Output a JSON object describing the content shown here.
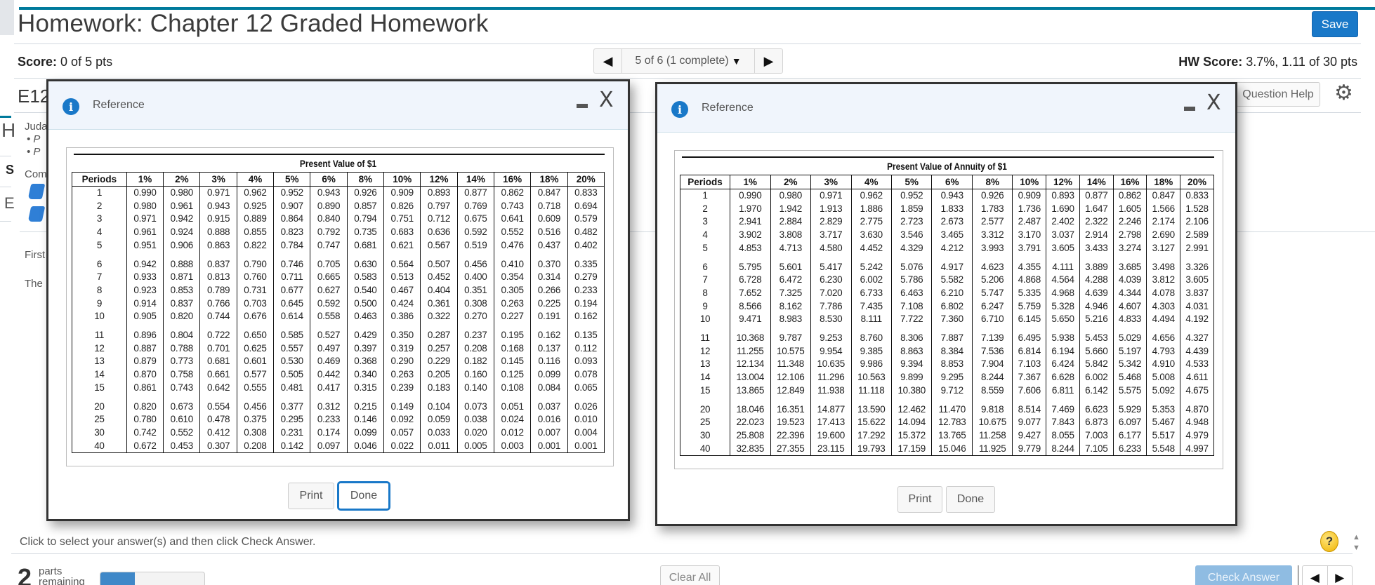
{
  "header": {
    "title": "Homework: Chapter 12 Graded Homework",
    "save_label": "Save",
    "score_label": "Score:",
    "score_value": "0 of 5 pts",
    "hw_score_label": "HW Score:",
    "hw_score_value": "3.7%, 1.11 of 30 pts",
    "nav": {
      "prev_icon": "◀",
      "position": "5 of 6 (1 complete)",
      "dropdown_icon": "▼",
      "next_icon": "▶"
    },
    "question_id": "E12",
    "question_help_label": "Question Help"
  },
  "background": {
    "partial_texts": [
      "Juda",
      "• P",
      "• P",
      "Com",
      "First",
      "The"
    ],
    "left_edge_texts": [
      "H",
      "S",
      "E"
    ]
  },
  "popups": [
    {
      "title": "Reference",
      "minimize_icon": "minimize",
      "close_icon": "X",
      "print_label": "Print",
      "done_label": "Done",
      "table": {
        "title": "Present Value of $1",
        "columns": [
          "Periods",
          "1%",
          "2%",
          "3%",
          "4%",
          "5%",
          "6%",
          "8%",
          "10%",
          "12%",
          "14%",
          "16%",
          "18%",
          "20%"
        ],
        "rows": [
          [
            "1",
            "0.990",
            "0.980",
            "0.971",
            "0.962",
            "0.952",
            "0.943",
            "0.926",
            "0.909",
            "0.893",
            "0.877",
            "0.862",
            "0.847",
            "0.833"
          ],
          [
            "2",
            "0.980",
            "0.961",
            "0.943",
            "0.925",
            "0.907",
            "0.890",
            "0.857",
            "0.826",
            "0.797",
            "0.769",
            "0.743",
            "0.718",
            "0.694"
          ],
          [
            "3",
            "0.971",
            "0.942",
            "0.915",
            "0.889",
            "0.864",
            "0.840",
            "0.794",
            "0.751",
            "0.712",
            "0.675",
            "0.641",
            "0.609",
            "0.579"
          ],
          [
            "4",
            "0.961",
            "0.924",
            "0.888",
            "0.855",
            "0.823",
            "0.792",
            "0.735",
            "0.683",
            "0.636",
            "0.592",
            "0.552",
            "0.516",
            "0.482"
          ],
          [
            "5",
            "0.951",
            "0.906",
            "0.863",
            "0.822",
            "0.784",
            "0.747",
            "0.681",
            "0.621",
            "0.567",
            "0.519",
            "0.476",
            "0.437",
            "0.402"
          ],
          [
            "6",
            "0.942",
            "0.888",
            "0.837",
            "0.790",
            "0.746",
            "0.705",
            "0.630",
            "0.564",
            "0.507",
            "0.456",
            "0.410",
            "0.370",
            "0.335"
          ],
          [
            "7",
            "0.933",
            "0.871",
            "0.813",
            "0.760",
            "0.711",
            "0.665",
            "0.583",
            "0.513",
            "0.452",
            "0.400",
            "0.354",
            "0.314",
            "0.279"
          ],
          [
            "8",
            "0.923",
            "0.853",
            "0.789",
            "0.731",
            "0.677",
            "0.627",
            "0.540",
            "0.467",
            "0.404",
            "0.351",
            "0.305",
            "0.266",
            "0.233"
          ],
          [
            "9",
            "0.914",
            "0.837",
            "0.766",
            "0.703",
            "0.645",
            "0.592",
            "0.500",
            "0.424",
            "0.361",
            "0.308",
            "0.263",
            "0.225",
            "0.194"
          ],
          [
            "10",
            "0.905",
            "0.820",
            "0.744",
            "0.676",
            "0.614",
            "0.558",
            "0.463",
            "0.386",
            "0.322",
            "0.270",
            "0.227",
            "0.191",
            "0.162"
          ],
          [
            "11",
            "0.896",
            "0.804",
            "0.722",
            "0.650",
            "0.585",
            "0.527",
            "0.429",
            "0.350",
            "0.287",
            "0.237",
            "0.195",
            "0.162",
            "0.135"
          ],
          [
            "12",
            "0.887",
            "0.788",
            "0.701",
            "0.625",
            "0.557",
            "0.497",
            "0.397",
            "0.319",
            "0.257",
            "0.208",
            "0.168",
            "0.137",
            "0.112"
          ],
          [
            "13",
            "0.879",
            "0.773",
            "0.681",
            "0.601",
            "0.530",
            "0.469",
            "0.368",
            "0.290",
            "0.229",
            "0.182",
            "0.145",
            "0.116",
            "0.093"
          ],
          [
            "14",
            "0.870",
            "0.758",
            "0.661",
            "0.577",
            "0.505",
            "0.442",
            "0.340",
            "0.263",
            "0.205",
            "0.160",
            "0.125",
            "0.099",
            "0.078"
          ],
          [
            "15",
            "0.861",
            "0.743",
            "0.642",
            "0.555",
            "0.481",
            "0.417",
            "0.315",
            "0.239",
            "0.183",
            "0.140",
            "0.108",
            "0.084",
            "0.065"
          ],
          [
            "20",
            "0.820",
            "0.673",
            "0.554",
            "0.456",
            "0.377",
            "0.312",
            "0.215",
            "0.149",
            "0.104",
            "0.073",
            "0.051",
            "0.037",
            "0.026"
          ],
          [
            "25",
            "0.780",
            "0.610",
            "0.478",
            "0.375",
            "0.295",
            "0.233",
            "0.146",
            "0.092",
            "0.059",
            "0.038",
            "0.024",
            "0.016",
            "0.010"
          ],
          [
            "30",
            "0.742",
            "0.552",
            "0.412",
            "0.308",
            "0.231",
            "0.174",
            "0.099",
            "0.057",
            "0.033",
            "0.020",
            "0.012",
            "0.007",
            "0.004"
          ],
          [
            "40",
            "0.672",
            "0.453",
            "0.307",
            "0.208",
            "0.142",
            "0.097",
            "0.046",
            "0.022",
            "0.011",
            "0.005",
            "0.003",
            "0.001",
            "0.001"
          ]
        ]
      }
    },
    {
      "title": "Reference",
      "minimize_icon": "minimize",
      "close_icon": "X",
      "print_label": "Print",
      "done_label": "Done",
      "table": {
        "title": "Present Value of Annuity of $1",
        "columns": [
          "Periods",
          "1%",
          "2%",
          "3%",
          "4%",
          "5%",
          "6%",
          "8%",
          "10%",
          "12%",
          "14%",
          "16%",
          "18%",
          "20%"
        ],
        "rows": [
          [
            "1",
            "0.990",
            "0.980",
            "0.971",
            "0.962",
            "0.952",
            "0.943",
            "0.926",
            "0.909",
            "0.893",
            "0.877",
            "0.862",
            "0.847",
            "0.833"
          ],
          [
            "2",
            "1.970",
            "1.942",
            "1.913",
            "1.886",
            "1.859",
            "1.833",
            "1.783",
            "1.736",
            "1.690",
            "1.647",
            "1.605",
            "1.566",
            "1.528"
          ],
          [
            "3",
            "2.941",
            "2.884",
            "2.829",
            "2.775",
            "2.723",
            "2.673",
            "2.577",
            "2.487",
            "2.402",
            "2.322",
            "2.246",
            "2.174",
            "2.106"
          ],
          [
            "4",
            "3.902",
            "3.808",
            "3.717",
            "3.630",
            "3.546",
            "3.465",
            "3.312",
            "3.170",
            "3.037",
            "2.914",
            "2.798",
            "2.690",
            "2.589"
          ],
          [
            "5",
            "4.853",
            "4.713",
            "4.580",
            "4.452",
            "4.329",
            "4.212",
            "3.993",
            "3.791",
            "3.605",
            "3.433",
            "3.274",
            "3.127",
            "2.991"
          ],
          [
            "6",
            "5.795",
            "5.601",
            "5.417",
            "5.242",
            "5.076",
            "4.917",
            "4.623",
            "4.355",
            "4.111",
            "3.889",
            "3.685",
            "3.498",
            "3.326"
          ],
          [
            "7",
            "6.728",
            "6.472",
            "6.230",
            "6.002",
            "5.786",
            "5.582",
            "5.206",
            "4.868",
            "4.564",
            "4.288",
            "4.039",
            "3.812",
            "3.605"
          ],
          [
            "8",
            "7.652",
            "7.325",
            "7.020",
            "6.733",
            "6.463",
            "6.210",
            "5.747",
            "5.335",
            "4.968",
            "4.639",
            "4.344",
            "4.078",
            "3.837"
          ],
          [
            "9",
            "8.566",
            "8.162",
            "7.786",
            "7.435",
            "7.108",
            "6.802",
            "6.247",
            "5.759",
            "5.328",
            "4.946",
            "4.607",
            "4.303",
            "4.031"
          ],
          [
            "10",
            "9.471",
            "8.983",
            "8.530",
            "8.111",
            "7.722",
            "7.360",
            "6.710",
            "6.145",
            "5.650",
            "5.216",
            "4.833",
            "4.494",
            "4.192"
          ],
          [
            "11",
            "10.368",
            "9.787",
            "9.253",
            "8.760",
            "8.306",
            "7.887",
            "7.139",
            "6.495",
            "5.938",
            "5.453",
            "5.029",
            "4.656",
            "4.327"
          ],
          [
            "12",
            "11.255",
            "10.575",
            "9.954",
            "9.385",
            "8.863",
            "8.384",
            "7.536",
            "6.814",
            "6.194",
            "5.660",
            "5.197",
            "4.793",
            "4.439"
          ],
          [
            "13",
            "12.134",
            "11.348",
            "10.635",
            "9.986",
            "9.394",
            "8.853",
            "7.904",
            "7.103",
            "6.424",
            "5.842",
            "5.342",
            "4.910",
            "4.533"
          ],
          [
            "14",
            "13.004",
            "12.106",
            "11.296",
            "10.563",
            "9.899",
            "9.295",
            "8.244",
            "7.367",
            "6.628",
            "6.002",
            "5.468",
            "5.008",
            "4.611"
          ],
          [
            "15",
            "13.865",
            "12.849",
            "11.938",
            "11.118",
            "10.380",
            "9.712",
            "8.559",
            "7.606",
            "6.811",
            "6.142",
            "5.575",
            "5.092",
            "4.675"
          ],
          [
            "20",
            "18.046",
            "16.351",
            "14.877",
            "13.590",
            "12.462",
            "11.470",
            "9.818",
            "8.514",
            "7.469",
            "6.623",
            "5.929",
            "5.353",
            "4.870"
          ],
          [
            "25",
            "22.023",
            "19.523",
            "17.413",
            "15.622",
            "14.094",
            "12.783",
            "10.675",
            "9.077",
            "7.843",
            "6.873",
            "6.097",
            "5.467",
            "4.948"
          ],
          [
            "30",
            "25.808",
            "22.396",
            "19.600",
            "17.292",
            "15.372",
            "13.765",
            "11.258",
            "9.427",
            "8.055",
            "7.003",
            "6.177",
            "5.517",
            "4.979"
          ],
          [
            "40",
            "32.835",
            "27.355",
            "23.115",
            "19.793",
            "17.159",
            "15.046",
            "11.925",
            "9.779",
            "8.244",
            "7.105",
            "6.233",
            "5.548",
            "4.997"
          ]
        ]
      }
    }
  ],
  "footer": {
    "instruction": "Click to select your answer(s) and then click Check Answer.",
    "parts_count": "2",
    "parts_label_1": "parts",
    "parts_label_2": "remaining",
    "progress_fraction": 0.33,
    "clear_all_label": "Clear All",
    "check_answer_label": "Check Answer",
    "help_label": "?",
    "prev_icon": "◀",
    "next_icon": "▶",
    "scroll_up_icon": "▲",
    "scroll_down_icon": "▼"
  },
  "colors": {
    "accent": "#1978c8",
    "top_bar": "#007a9c",
    "check_answer_disabled": "#8fbce2",
    "progress_fill": "#3f88c8"
  }
}
